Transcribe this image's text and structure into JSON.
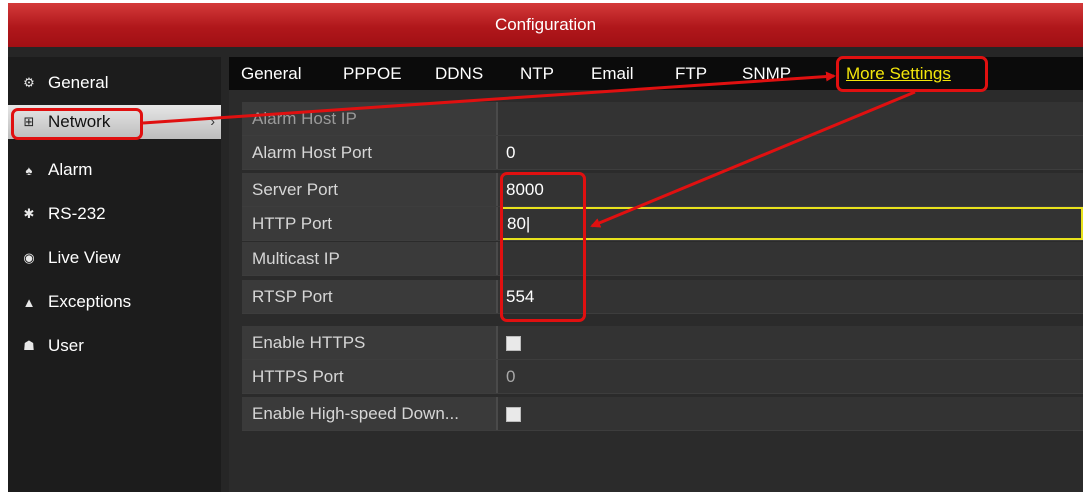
{
  "window": {
    "title": "Configuration"
  },
  "sidebar": {
    "items": [
      {
        "label": "General",
        "icon": "gear-icon"
      },
      {
        "label": "Network",
        "icon": "network-icon",
        "active": true
      },
      {
        "label": "Alarm",
        "icon": "alarm-icon"
      },
      {
        "label": "RS-232",
        "icon": "serial-port-icon"
      },
      {
        "label": "Live View",
        "icon": "eye-icon"
      },
      {
        "label": "Exceptions",
        "icon": "warning-icon"
      },
      {
        "label": "User",
        "icon": "users-icon"
      }
    ]
  },
  "tabs": [
    {
      "label": "General"
    },
    {
      "label": "PPPOE"
    },
    {
      "label": "DDNS"
    },
    {
      "label": "NTP"
    },
    {
      "label": "Email"
    },
    {
      "label": "FTP"
    },
    {
      "label": "SNMP"
    },
    {
      "label": "More Settings",
      "selected": true
    }
  ],
  "form": {
    "rows": [
      {
        "label": "Alarm Host IP",
        "value": ""
      },
      {
        "label": "Alarm Host Port",
        "value": "0"
      },
      {
        "label": "Server Port",
        "value": "8000"
      },
      {
        "label": "HTTP Port",
        "value": "80|"
      },
      {
        "label": "Multicast IP",
        "value": ""
      },
      {
        "label": "RTSP Port",
        "value": "554"
      },
      {
        "label": "Enable HTTPS",
        "value": "",
        "checkbox": true
      },
      {
        "label": "HTTPS Port",
        "value": "0"
      },
      {
        "label": "Enable High-speed Down...",
        "value": "",
        "checkbox": true
      }
    ]
  },
  "colors": {
    "title_bar": "#b0171b",
    "selected_tab": "#f3e60b",
    "annotation": "#e01010",
    "focus_border": "#e8e21c"
  }
}
